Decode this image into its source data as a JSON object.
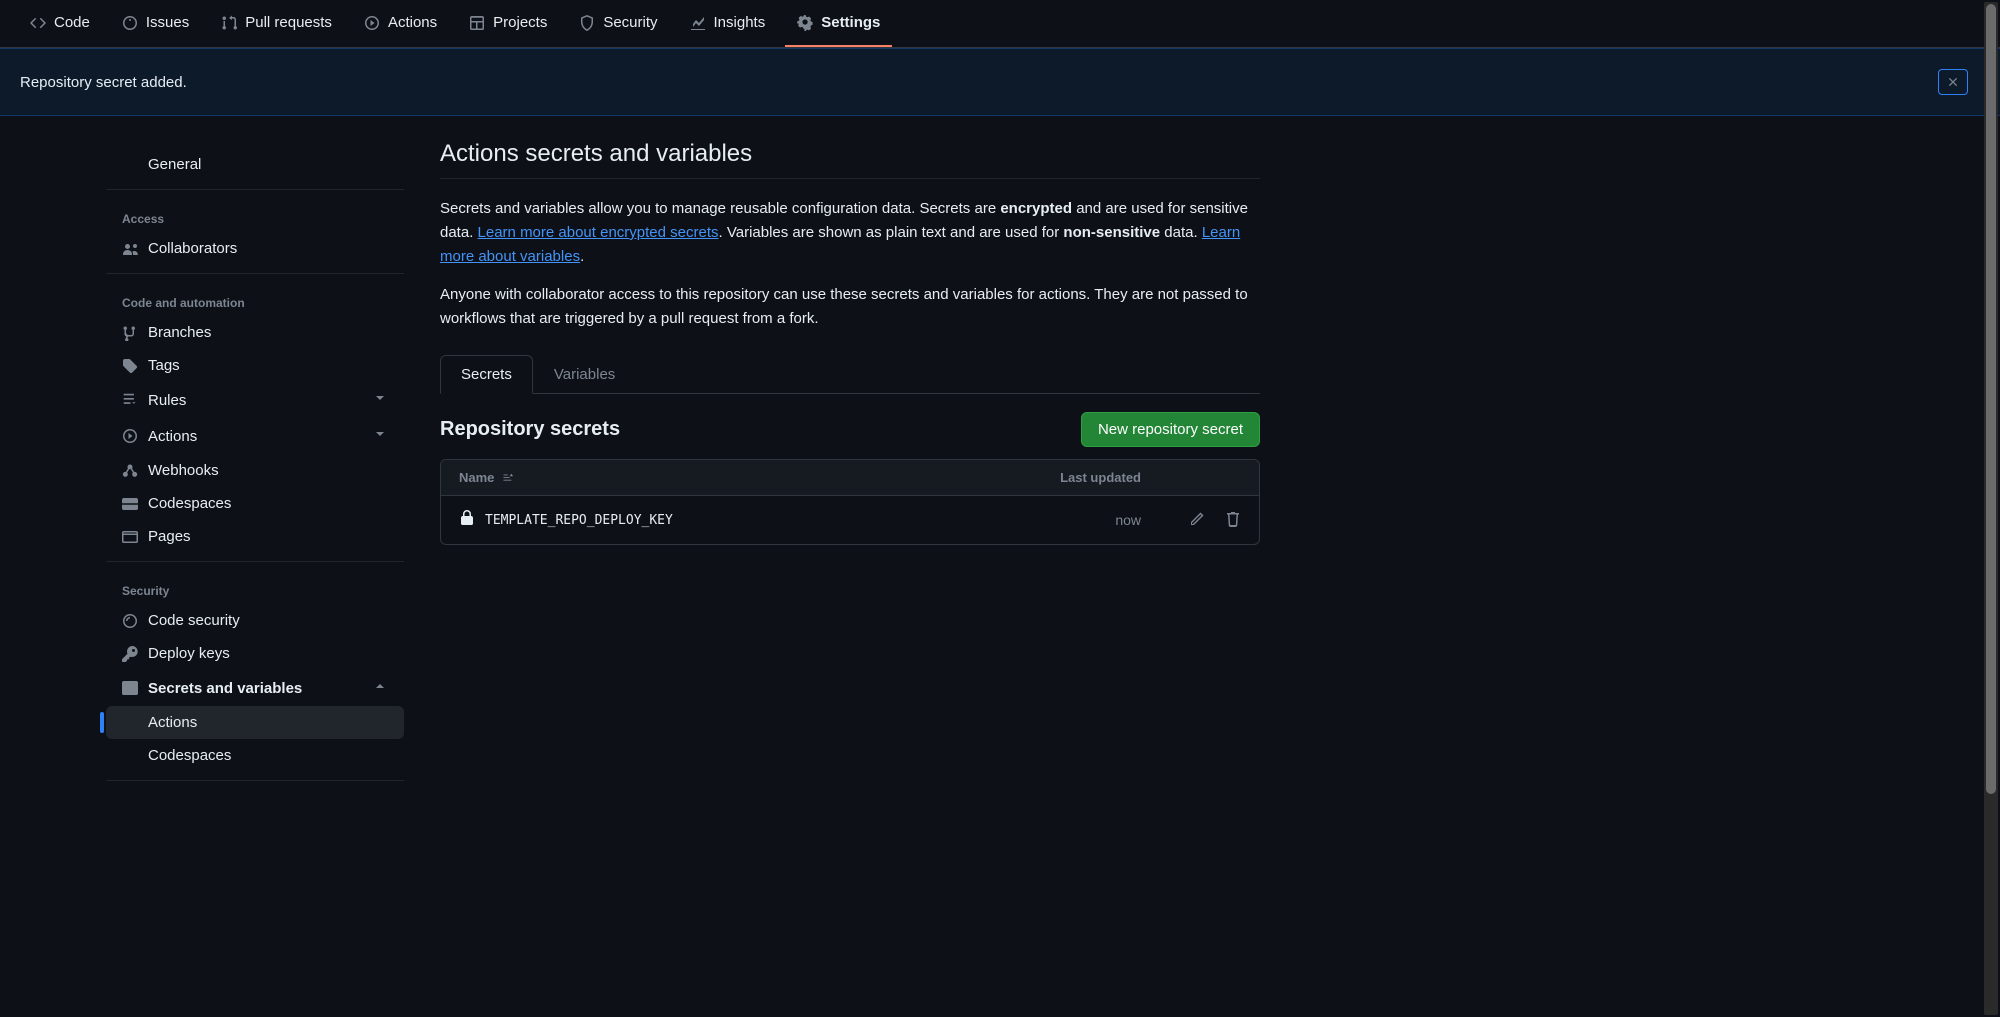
{
  "tabs": [
    {
      "label": "Code",
      "icon": "code"
    },
    {
      "label": "Issues",
      "icon": "issue"
    },
    {
      "label": "Pull requests",
      "icon": "pr"
    },
    {
      "label": "Actions",
      "icon": "play"
    },
    {
      "label": "Projects",
      "icon": "table"
    },
    {
      "label": "Security",
      "icon": "shield"
    },
    {
      "label": "Insights",
      "icon": "graph"
    },
    {
      "label": "Settings",
      "icon": "gear",
      "active": true
    }
  ],
  "flash": {
    "message": "Repository secret added."
  },
  "sidebar": {
    "general": "General",
    "groups": [
      {
        "heading": "Access",
        "items": [
          {
            "label": "Collaborators",
            "icon": "people"
          }
        ]
      },
      {
        "heading": "Code and automation",
        "items": [
          {
            "label": "Branches",
            "icon": "branch"
          },
          {
            "label": "Tags",
            "icon": "tag"
          },
          {
            "label": "Rules",
            "icon": "rules",
            "expandable": true
          },
          {
            "label": "Actions",
            "icon": "play",
            "expandable": true
          },
          {
            "label": "Webhooks",
            "icon": "webhook"
          },
          {
            "label": "Codespaces",
            "icon": "codespaces"
          },
          {
            "label": "Pages",
            "icon": "browser"
          }
        ]
      },
      {
        "heading": "Security",
        "items": [
          {
            "label": "Code security",
            "icon": "scan"
          },
          {
            "label": "Deploy keys",
            "icon": "key"
          },
          {
            "label": "Secrets and variables",
            "icon": "asterisk",
            "expandable": true,
            "expanded": true,
            "bold": true,
            "children": [
              {
                "label": "Actions",
                "selected": true
              },
              {
                "label": "Codespaces"
              }
            ]
          }
        ]
      }
    ]
  },
  "main": {
    "title": "Actions secrets and variables",
    "desc1_a": "Secrets and variables allow you to manage reusable configuration data. Secrets are ",
    "desc1_bold": "encrypted",
    "desc1_b": " and are used for sensitive data. ",
    "link1": "Learn more about encrypted secrets",
    "desc1_c": ". Variables are shown as plain text and are used for ",
    "desc1_bold2": "non-sensitive",
    "desc1_d": " data. ",
    "link2": "Learn more about variables",
    "desc1_e": ".",
    "desc2": "Anyone with collaborator access to this repository can use these secrets and variables for actions. They are not passed to workflows that are triggered by a pull request from a fork.",
    "inner_tabs": [
      {
        "label": "Secrets",
        "active": true
      },
      {
        "label": "Variables"
      }
    ],
    "subsection_title": "Repository secrets",
    "new_button": "New repository secret",
    "table": {
      "cols": {
        "name": "Name",
        "updated": "Last updated"
      },
      "rows": [
        {
          "name": "TEMPLATE_REPO_DEPLOY_KEY",
          "updated": "now"
        }
      ]
    }
  }
}
